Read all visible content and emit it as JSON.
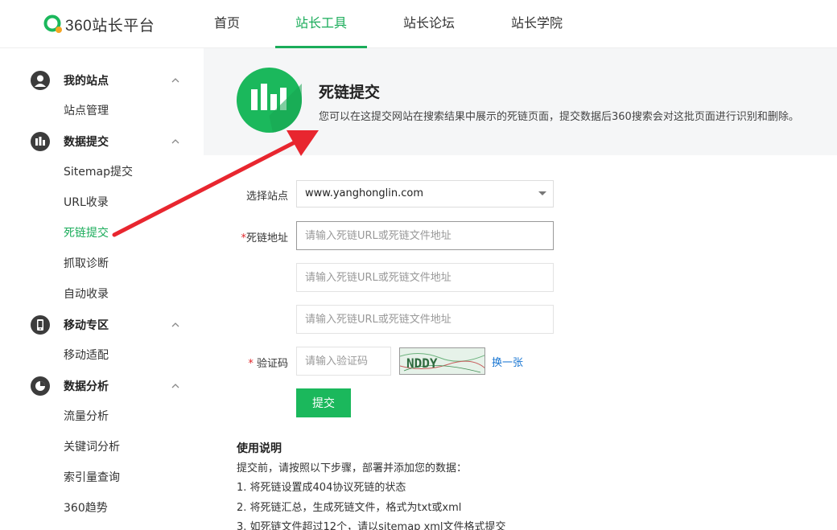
{
  "logo": {
    "text": "360站长平台",
    "brand_color": "#1bb85c",
    "accent_color": "#f5a623"
  },
  "nav": {
    "items": [
      {
        "label": "首页",
        "active": false
      },
      {
        "label": "站长工具",
        "active": true
      },
      {
        "label": "站长论坛",
        "active": false
      },
      {
        "label": "站长学院",
        "active": false
      }
    ]
  },
  "sidebar": {
    "groups": [
      {
        "label": "我的站点",
        "icon": "user-icon",
        "items": [
          "站点管理"
        ]
      },
      {
        "label": "数据提交",
        "icon": "bar-chart-icon",
        "items": [
          "Sitemap提交",
          "URL收录",
          "死链提交",
          "抓取诊断",
          "自动收录"
        ]
      },
      {
        "label": "移动专区",
        "icon": "mobile-icon",
        "items": [
          "移动适配"
        ]
      },
      {
        "label": "数据分析",
        "icon": "pie-chart-icon",
        "items": [
          "流量分析",
          "关键词分析",
          "索引量查询",
          "360趋势"
        ]
      }
    ],
    "active_item": "死链提交"
  },
  "banner": {
    "title": "死链提交",
    "description": "您可以在这提交网站在搜索结果中展示的死链页面，提交数据后360搜索会对这批页面进行识别和删除。"
  },
  "form": {
    "site_label": "选择站点",
    "site_value": "www.yanghonglin.com",
    "deadlink_label": "死链地址",
    "required_mark": "*",
    "url_placeholder": "请输入死链URL或死链文件地址",
    "captcha_label": "验证码",
    "captcha_placeholder": "请输入验证码",
    "captcha_text": "NDDY",
    "refresh_label": "换一张",
    "submit_label": "提交"
  },
  "usage": {
    "title": "使用说明",
    "lines": [
      "提交前，请按照以下步骤，部署并添加您的数据：",
      "1. 将死链设置成404协议死链的状态",
      "2. 将死链汇总，生成死链文件，格式为txt或xml",
      "3. 如死链文件超过12个，请以sitemap xml文件格式提交"
    ]
  },
  "colors": {
    "primary": "#1bb85c",
    "annotation_arrow": "#e8262f",
    "link": "#1976d2"
  }
}
